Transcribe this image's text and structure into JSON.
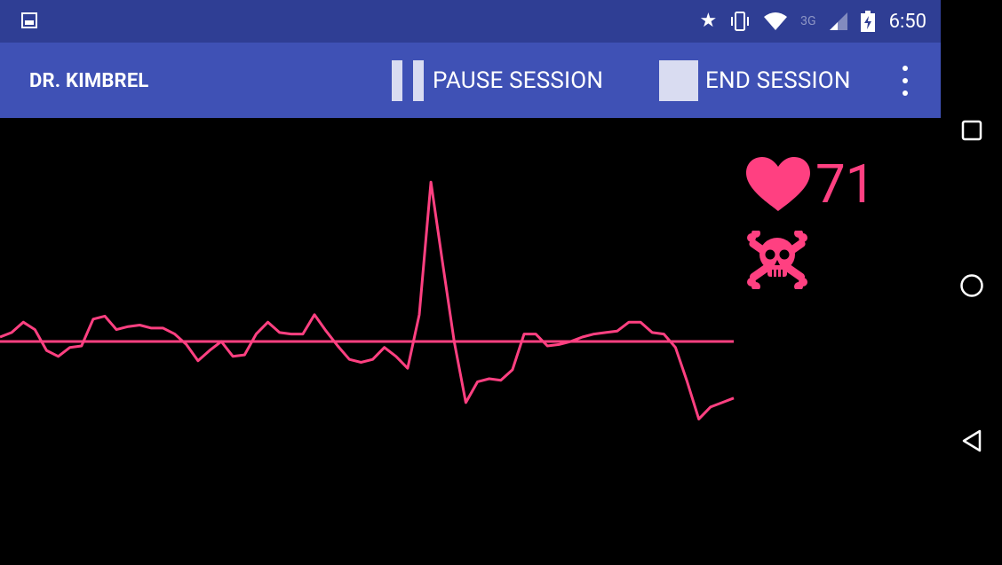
{
  "status_bar": {
    "time": "6:50",
    "icons": [
      "image-icon",
      "star-icon",
      "vibrate-icon",
      "wifi-icon",
      "3g-icon",
      "signal-icon",
      "battery-charging-icon"
    ]
  },
  "app_bar": {
    "title": "DR. KIMBREL",
    "pause_label": "PAUSE SESSION",
    "end_label": "END SESSION",
    "overflow_icon": "more-vert-icon",
    "background_color": "#3f51b5",
    "status_color": "#2f3e94"
  },
  "vitals": {
    "heart_rate": "71",
    "heart_icon": "heart-icon",
    "alert_icon": "skull-crossbones-icon",
    "accent_color": "#ff4081"
  },
  "navigation": {
    "recents_icon": "square-icon",
    "home_icon": "circle-icon",
    "back_icon": "triangle-back-icon"
  },
  "chart_data": {
    "type": "line",
    "series": [
      {
        "values": [
          0.3,
          0.6,
          1.3,
          0.8,
          -0.6,
          -1.0,
          -0.4,
          -0.3,
          1.5,
          1.7,
          0.8,
          1.0,
          1.1,
          0.9,
          0.9,
          0.5,
          -0.2,
          -1.3,
          -0.6,
          0.0,
          -1.0,
          -0.9,
          0.5,
          1.3,
          0.6,
          0.5,
          0.5,
          1.8,
          0.7,
          -0.3,
          -1.2,
          -1.4,
          -1.2,
          -0.4,
          -1.0,
          -1.8,
          1.8,
          10.7,
          5.3,
          0.0,
          -4.1,
          -2.7,
          -2.5,
          -2.6,
          -1.9,
          0.5,
          0.5,
          -0.3,
          -0.2,
          0.0,
          0.3,
          0.5,
          0.6,
          0.7,
          1.3,
          1.3,
          0.6,
          0.5,
          -0.4,
          -2.7,
          -5.2,
          -4.4,
          -4.1,
          -3.8
        ]
      },
      {
        "values": [
          0,
          0
        ]
      }
    ],
    "baseline_y": 0,
    "line_color": "#ff4081"
  }
}
